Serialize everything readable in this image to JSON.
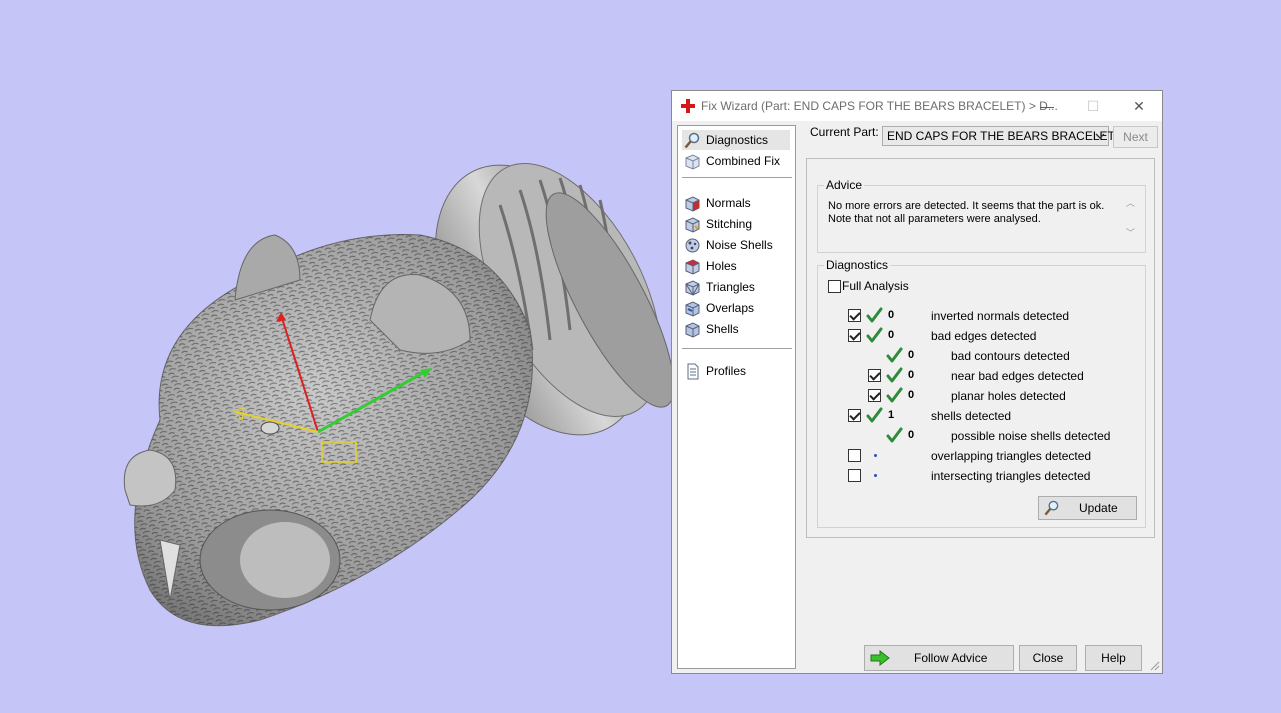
{
  "window": {
    "title": "Fix Wizard (Part: END CAPS FOR THE BEARS BRACELET) > D...",
    "minimize": "—",
    "maximize": "☐",
    "close": "✕"
  },
  "sidebar": {
    "items": [
      {
        "label": "Diagnostics",
        "icon": "magnifier-icon",
        "selected": true
      },
      {
        "label": "Combined Fix",
        "icon": "cube-icon"
      },
      {
        "label": "Normals",
        "icon": "normals-cube-icon"
      },
      {
        "label": "Stitching",
        "icon": "stitching-cube-icon"
      },
      {
        "label": "Noise Shells",
        "icon": "noise-shells-icon"
      },
      {
        "label": "Holes",
        "icon": "holes-cube-icon"
      },
      {
        "label": "Triangles",
        "icon": "triangles-cube-icon"
      },
      {
        "label": "Overlaps",
        "icon": "overlaps-cube-icon"
      },
      {
        "label": "Shells",
        "icon": "shells-cube-icon"
      },
      {
        "label": "Profiles",
        "icon": "document-icon"
      }
    ]
  },
  "current_part": {
    "label": "Current Part:",
    "value": "END CAPS FOR THE BEARS BRACELET",
    "next": "Next"
  },
  "advice": {
    "title": "Advice",
    "text": "No more errors are detected. It seems that the part is ok.\nNote that not all parameters were analysed."
  },
  "diagnostics": {
    "title": "Diagnostics",
    "full_analysis": {
      "label": "Full Analysis",
      "checked": false
    },
    "rows": [
      {
        "checkbox": true,
        "checked": true,
        "status": "ok",
        "count": "0",
        "label": "inverted normals detected",
        "indent": 0
      },
      {
        "checkbox": true,
        "checked": true,
        "status": "ok",
        "count": "0",
        "label": "bad edges detected",
        "indent": 0
      },
      {
        "checkbox": false,
        "checked": false,
        "status": "ok",
        "count": "0",
        "label": "bad contours detected",
        "indent": 1
      },
      {
        "checkbox": true,
        "checked": true,
        "status": "ok",
        "count": "0",
        "label": "near bad edges detected",
        "indent": 1
      },
      {
        "checkbox": true,
        "checked": true,
        "status": "ok",
        "count": "0",
        "label": "planar holes detected",
        "indent": 1
      },
      {
        "checkbox": true,
        "checked": true,
        "status": "ok",
        "count": "1",
        "label": "shells detected",
        "indent": 0
      },
      {
        "checkbox": false,
        "checked": false,
        "status": "ok",
        "count": "0",
        "label": "possible noise shells detected",
        "indent": 1
      },
      {
        "checkbox": true,
        "checked": false,
        "status": "not-analysed",
        "count": "",
        "label": "overlapping triangles detected",
        "indent": 0
      },
      {
        "checkbox": true,
        "checked": false,
        "status": "not-analysed",
        "count": "",
        "label": "intersecting triangles detected",
        "indent": 0
      }
    ],
    "update": "Update"
  },
  "footer": {
    "follow_advice": "Follow Advice",
    "close": "Close",
    "help": "Help"
  },
  "colors": {
    "viewport_bg": "#c5c5f8",
    "check_green": "#2e8b3a",
    "axis_x": "#dd2020",
    "axis_y": "#33cc33",
    "axis_z": "#e6d22a"
  }
}
